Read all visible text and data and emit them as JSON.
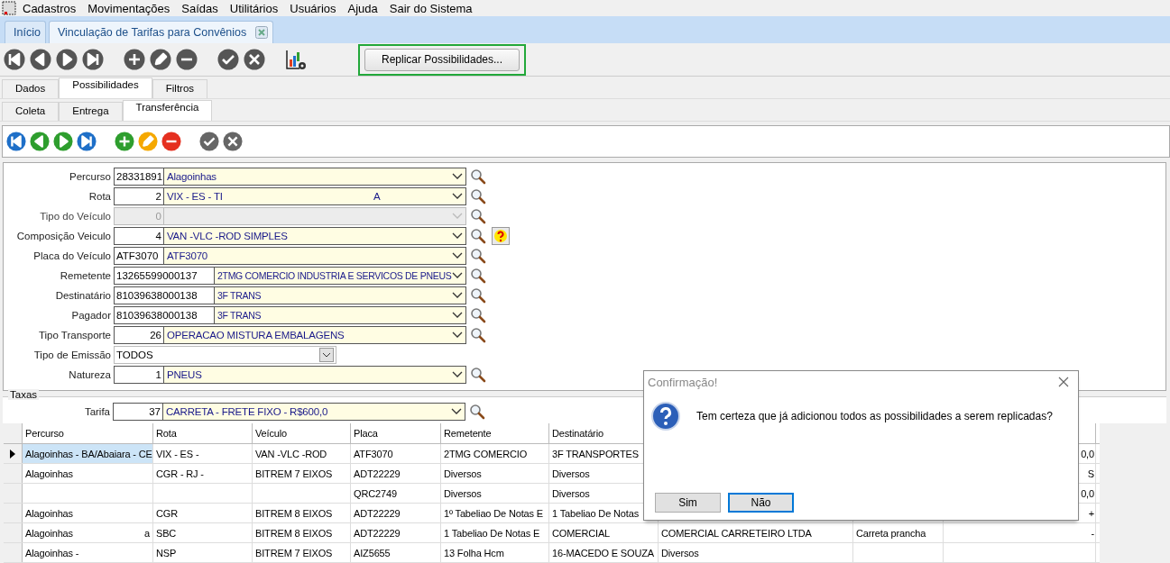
{
  "menu": [
    {
      "label": "Cadastros"
    },
    {
      "label": "Movimentações"
    },
    {
      "label": "Saídas"
    },
    {
      "label": "Utilitários"
    },
    {
      "label": "Usuários"
    },
    {
      "label": "Ajuda"
    },
    {
      "label": "Sair do Sistema"
    }
  ],
  "doc_tabs": [
    {
      "label": "Início",
      "selected": false,
      "closable": false
    },
    {
      "label": "Vinculação de Tarifas para Convênios",
      "selected": true,
      "closable": true
    }
  ],
  "replicate_button": {
    "label": "Replicar Possibilidades...",
    "highlighted": true
  },
  "tabs": [
    {
      "label": "Dados",
      "selected": false
    },
    {
      "label": "Possibilidades",
      "selected": true
    },
    {
      "label": "Filtros",
      "selected": false
    }
  ],
  "subtabs": [
    {
      "label": "Coleta",
      "selected": false
    },
    {
      "label": "Entrega",
      "selected": false
    },
    {
      "label": "Transferência",
      "selected": true
    }
  ],
  "form": [
    {
      "label": "Percurso",
      "kind": "text",
      "code": "28331891",
      "value": "Alagoinhas",
      "disabled": false
    },
    {
      "label": "Rota",
      "kind": "number",
      "code": "2",
      "value": "VIX - ES - TI",
      "value_end": "A",
      "disabled": false
    },
    {
      "label": "Tipo do Veículo",
      "kind": "number",
      "code": "0",
      "disabled": true
    },
    {
      "label": "Composição Veiculo",
      "kind": "number",
      "code": "4",
      "value": "VAN -VLC  -ROD SIMPLES",
      "disabled": false,
      "help": true
    },
    {
      "label": "Placa do Veículo",
      "kind": "text",
      "code": "ATF3070",
      "value": "ATF3070",
      "disabled": false
    },
    {
      "label": "Remetente",
      "kind": "wide",
      "code": "13265599000137",
      "value": "2TMG COMERCIO INDUSTRIA E SERVICOS DE PNEUS",
      "disabled": false
    },
    {
      "label": "Destinatário",
      "kind": "wide",
      "code": "81039638000138",
      "value": "3F TRANS",
      "disabled": false
    },
    {
      "label": "Pagador",
      "kind": "wide",
      "code": "81039638000138",
      "value": "3F TRANS",
      "disabled": false
    },
    {
      "label": "Tipo Transporte",
      "kind": "number",
      "code": "26",
      "value": "OPERACAO MISTURA EMBALAGENS",
      "disabled": false
    },
    {
      "label": "Tipo de Emissão",
      "kind": "select",
      "value": "TODOS"
    },
    {
      "label": "Natureza",
      "kind": "number",
      "code": "1",
      "value": "PNEUS",
      "disabled": false
    }
  ],
  "taxas": {
    "title": "Taxas",
    "field": {
      "label": "Tarifa",
      "kind": "number",
      "code": "37",
      "value": "CARRETA - FRETE FIXO - R$600,0",
      "disabled": false
    }
  },
  "table": {
    "columns": [
      "Percurso",
      "Rota",
      "Veículo",
      "Placa",
      "Remetente",
      "Destinatário"
    ],
    "rows": [
      {
        "selected": true,
        "percurso": "Alagoinhas - BA/Abaiara - CE",
        "rota": "VIX - ES -",
        "veiculo": "VAN -VLC  -ROD",
        "placa": "ATF3070",
        "remetente": "2TMG COMERCIO",
        "destinatario": "3F TRANSPORTES",
        "column_9": "0,0"
      },
      {
        "selected": false,
        "percurso": "Alagoinhas",
        "rota": "CGR - RJ -",
        "veiculo": "BITREM 7 EIXOS",
        "placa": "ADT22229",
        "remetente": "Diversos",
        "destinatario": "Diversos",
        "column_9": "S"
      },
      {
        "selected": false,
        "placa": "QRC2749",
        "remetente": "Diversos",
        "destinatario": "Diversos",
        "column_9": "0,0"
      },
      {
        "selected": false,
        "percurso": "Alagoinhas",
        "rota": "CGR",
        "veiculo": "BITREM 8 EIXOS",
        "placa": "ADT22229",
        "remetente": "1º Tabeliao De Notas E",
        "destinatario": "1 Tabeliao De Notas",
        "column_9": "+"
      },
      {
        "selected": false,
        "percurso": "Alagoinhas",
        "percurso_end": "a",
        "rota": "SBC",
        "veiculo": "BITREM 8 EIXOS",
        "placa": "ADT22229",
        "remetente": "1 Tabeliao De Notas E",
        "destinatario": " COMERCIAL",
        "column_7": "COMERCIAL CARRETEIRO LTDA",
        "column_8": "Carreta prancha",
        "column_9": "-"
      },
      {
        "selected": false,
        "percurso": "Alagoinhas -",
        "rota": "NSP",
        "veiculo": "BITREM 7 EIXOS",
        "placa": "AIZ5655",
        "remetente": "13 Folha Hcm",
        "destinatario": "16-MACEDO E SOUZA",
        "column_7": "Diversos"
      }
    ]
  },
  "dialog": {
    "title": "Confirmação!",
    "message": "Tem certeza que já adicionou todos as possibilidades a serem replicadas?",
    "buttons": [
      {
        "label": "Sim",
        "focused": false
      },
      {
        "label": "Não",
        "focused": true
      }
    ]
  }
}
